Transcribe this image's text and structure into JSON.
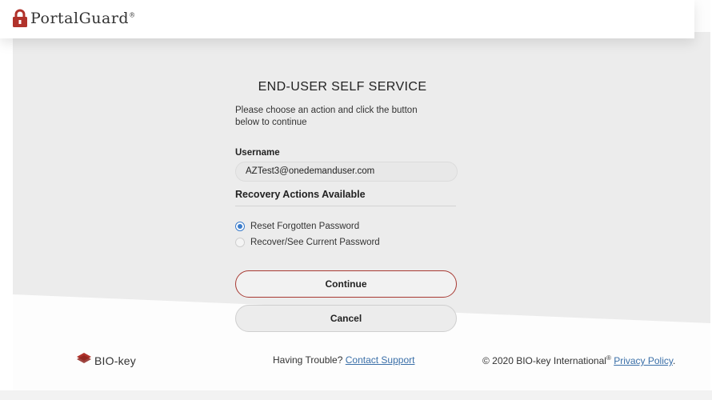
{
  "header": {
    "logo_text": "PortalGuard",
    "logo_mark": "®",
    "brand_color": "#b0322b"
  },
  "main": {
    "title": "END-USER SELF SERVICE",
    "instructions": "Please choose an action and click the button below to continue",
    "username_label": "Username",
    "username_value": "AZTest3@onedemanduser.com",
    "recovery_heading": "Recovery Actions Available",
    "options": [
      {
        "label": "Reset Forgotten Password",
        "checked": true
      },
      {
        "label": "Recover/See Current Password",
        "checked": false
      }
    ],
    "continue_label": "Continue",
    "cancel_label": "Cancel"
  },
  "footer": {
    "logo_text": "BIO-key",
    "trouble_text": "Having Trouble?",
    "contact_link": "Contact Support",
    "copyright": "© 2020 BIO-key International",
    "registered": "®",
    "privacy_link": "Privacy Policy",
    "period": "."
  },
  "colors": {
    "accent_red": "#a83a33",
    "radio_blue": "#3b7ccb",
    "link_blue": "#3a6fa8"
  },
  "icons": {
    "header_logo": "padlock-icon",
    "footer_logo": "bio-key-logo-icon"
  }
}
